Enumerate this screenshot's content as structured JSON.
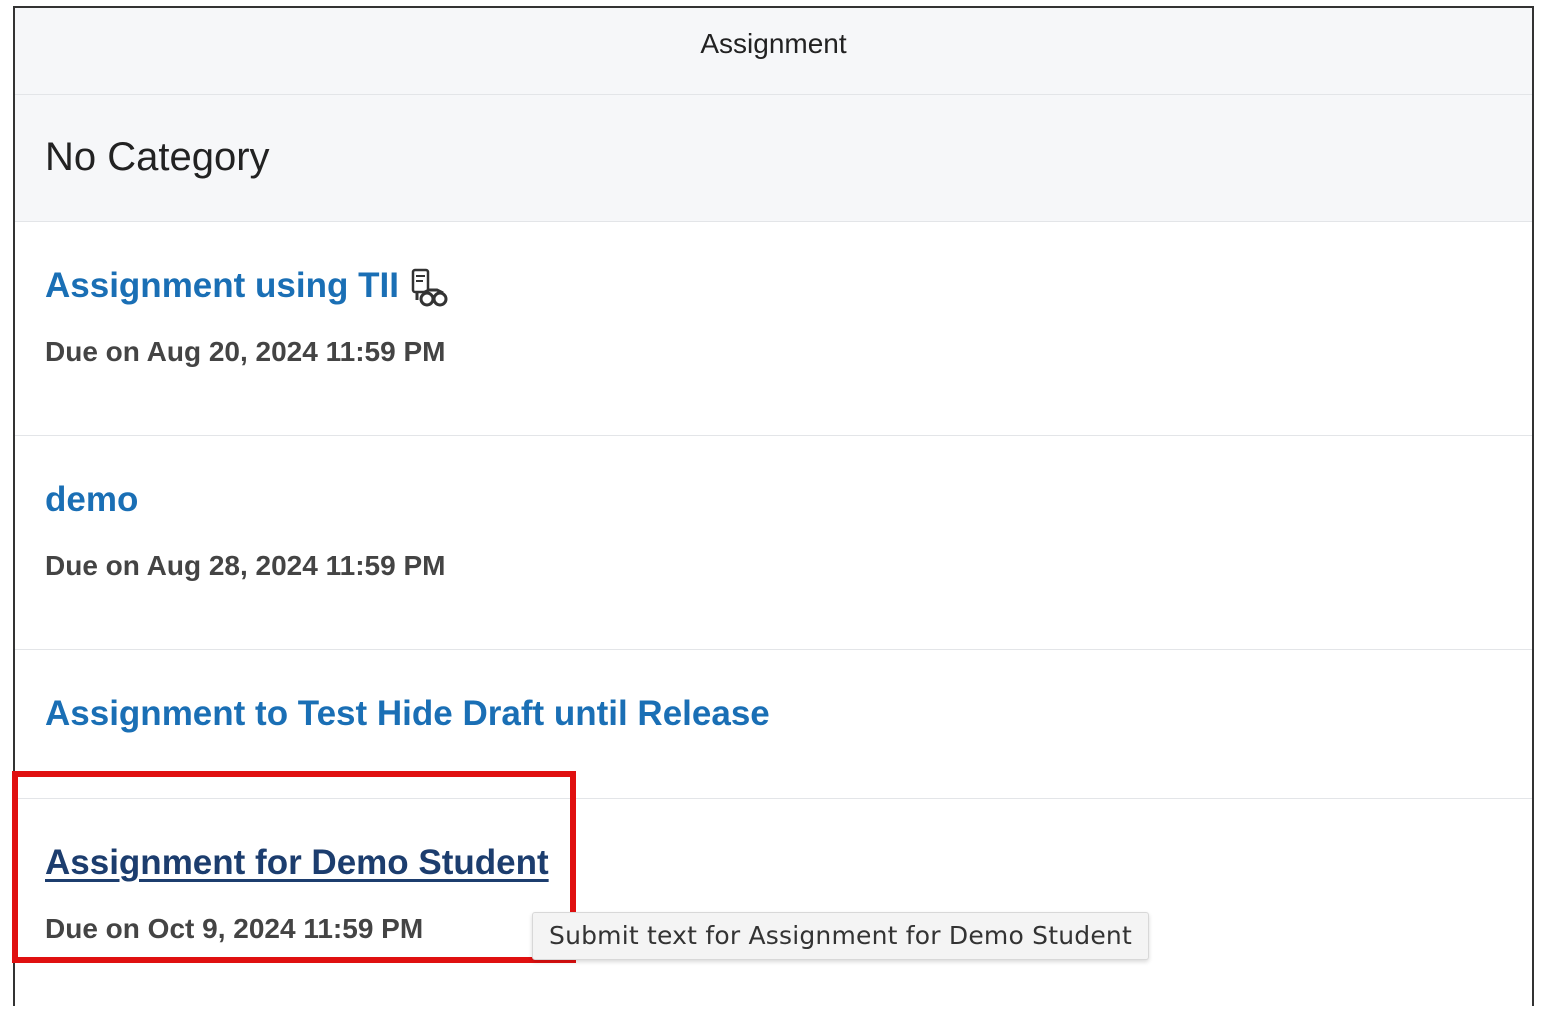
{
  "header": {
    "title": "Assignment"
  },
  "category": {
    "title": "No Category"
  },
  "assignments": [
    {
      "title": "Assignment using TII",
      "due": "Due on Aug 20, 2024 11:59 PM",
      "icon": "turnitin-icon"
    },
    {
      "title": "demo",
      "due": "Due on Aug 28, 2024 11:59 PM"
    },
    {
      "title": "Assignment to Test Hide Draft until Release",
      "due": ""
    },
    {
      "title": "Assignment for Demo Student",
      "due": "Due on Oct 9, 2024 11:59 PM"
    }
  ],
  "tooltip": {
    "text": "Submit text for Assignment for Demo Student"
  },
  "colors": {
    "link": "#1a6fb5",
    "link_hover": "#1c3d6e",
    "highlight": "#e01010"
  }
}
